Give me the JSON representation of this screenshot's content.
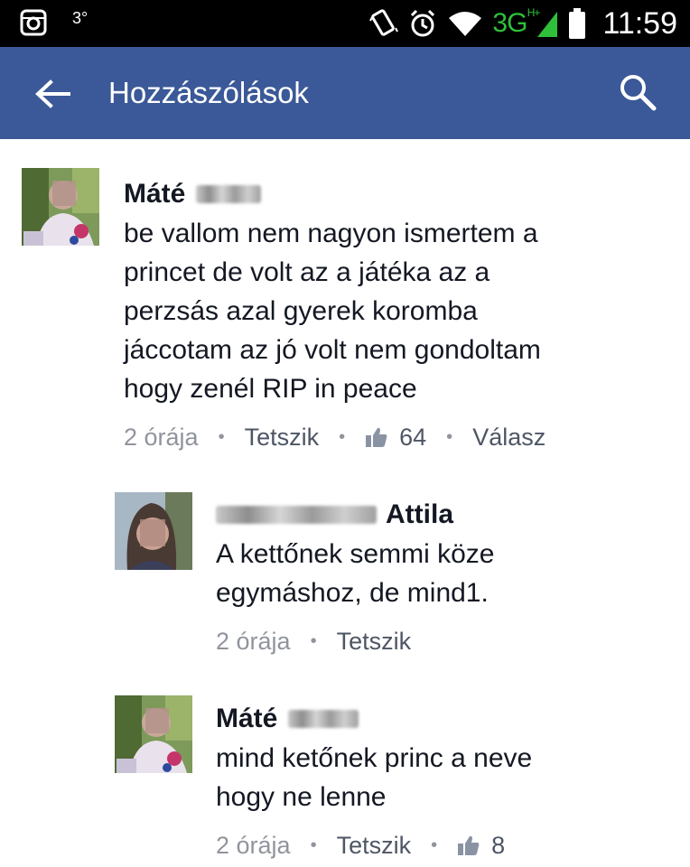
{
  "status_bar": {
    "left_icons": [
      "instagram-icon"
    ],
    "temperature": "3°",
    "network_label": "3G",
    "network_sup": "H+",
    "time": "11:59"
  },
  "app_bar": {
    "title": "Hozzászólások",
    "color": "#3b5998"
  },
  "comments": [
    {
      "author_first": "Máté",
      "author_last_blurred": true,
      "lines": [
        "be vallom nem nagyon ismertem a",
        "princet de volt az a játéka az a",
        "perzsás azal gyerek koromba",
        "jáccotam az jó volt nem gondoltam",
        "hogy zenél RIP in peace"
      ],
      "time": "2 órája",
      "like_action": "Tetszik",
      "like_count": "64",
      "reply_action": "Válasz"
    },
    {
      "author_first_blurred": true,
      "author_last": "Attila",
      "lines": [
        "A kettőnek semmi köze",
        "egymáshoz, de mind1."
      ],
      "time": "2 órája",
      "like_action": "Tetszik"
    },
    {
      "author_first": "Máté",
      "author_last_blurred": true,
      "lines": [
        "mind ketőnek princ a neve",
        "hogy ne lenne"
      ],
      "time": "2 órája",
      "like_action": "Tetszik",
      "like_count": "8"
    }
  ]
}
